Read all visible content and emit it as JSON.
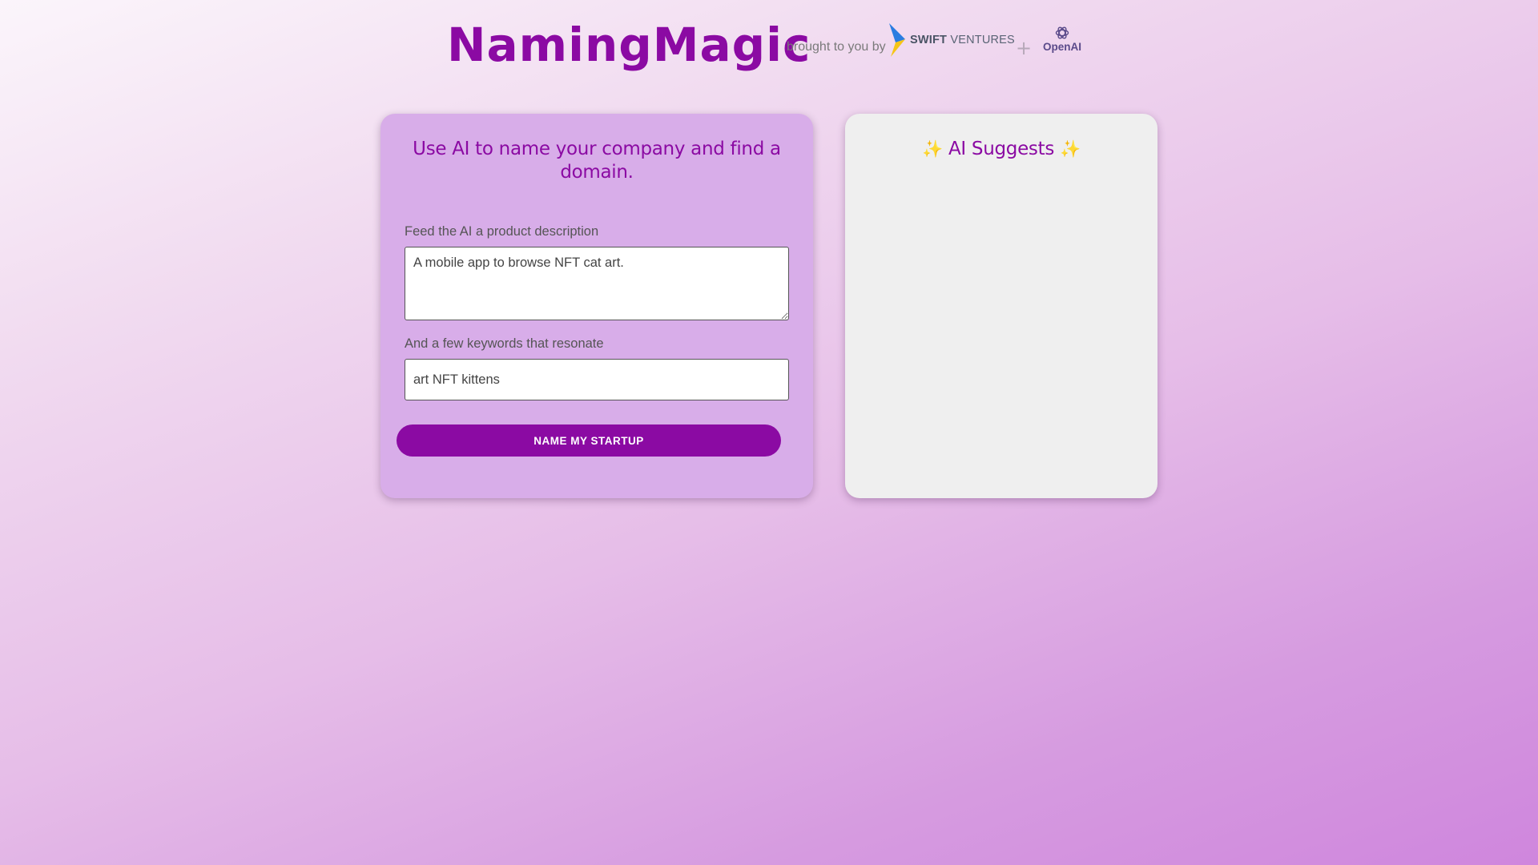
{
  "header": {
    "brand": "NamingMagic",
    "brought_by": "brought to you by",
    "sponsor_1_bold": "SWIFT",
    "sponsor_1_rest": "VENTURES",
    "separator": "+",
    "sponsor_2": "OpenAI"
  },
  "form_card": {
    "title": "Use AI to name your company and find a domain.",
    "description_label": "Feed the AI a product description",
    "description_value": "A mobile app to browse NFT cat art.",
    "keywords_label": "And a few keywords that resonate",
    "keywords_value": "art NFT kittens",
    "submit_label": "NAME MY STARTUP"
  },
  "results_card": {
    "sparkle_left": "✨",
    "title": "AI Suggests",
    "sparkle_right": "✨"
  },
  "colors": {
    "brand": "#8b0aa3",
    "form_card_bg": "#d8ade9",
    "results_card_bg": "#efefef"
  },
  "icons": [
    "swift-ventures-logo-icon",
    "openai-logo-icon"
  ]
}
